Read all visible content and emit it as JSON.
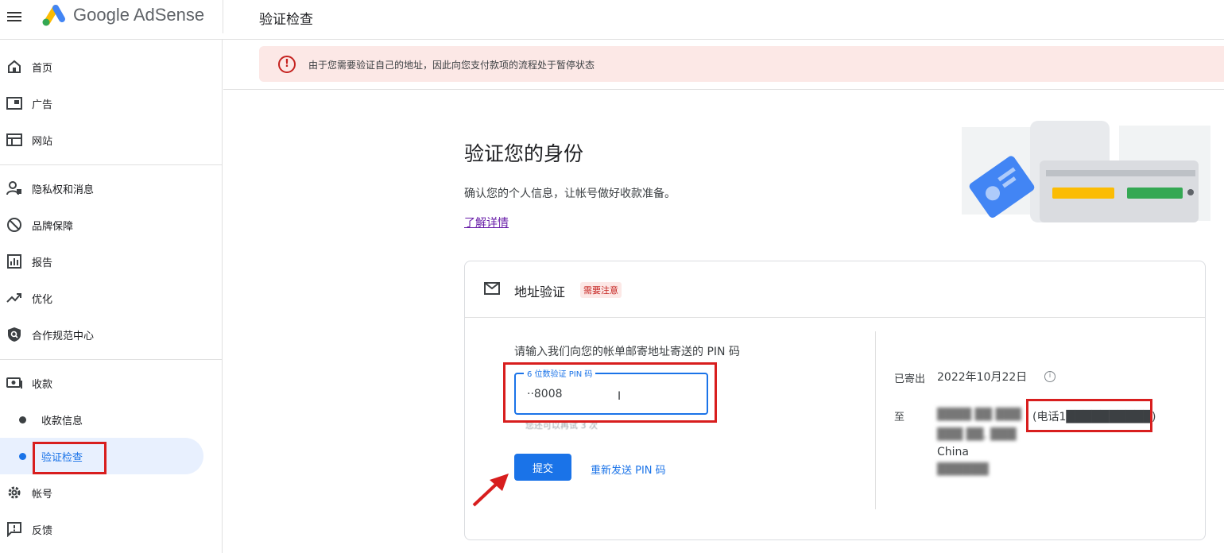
{
  "topbar": {
    "brand": "Google AdSense",
    "page_title": "验证检查"
  },
  "sidebar": {
    "items": [
      {
        "label": "首页",
        "icon": "home-icon"
      },
      {
        "label": "广告",
        "icon": "ads-icon"
      },
      {
        "label": "网站",
        "icon": "sites-icon"
      },
      {
        "label": "隐私权和消息",
        "icon": "privacy-icon"
      },
      {
        "label": "品牌保障",
        "icon": "block-icon"
      },
      {
        "label": "报告",
        "icon": "reports-icon"
      },
      {
        "label": "优化",
        "icon": "trending-icon"
      },
      {
        "label": "合作规范中心",
        "icon": "policy-icon"
      },
      {
        "label": "收款",
        "icon": "payments-icon"
      },
      {
        "label": "收款信息"
      },
      {
        "label": "验证检查"
      },
      {
        "label": "帐号",
        "icon": "gear-icon"
      },
      {
        "label": "反馈",
        "icon": "feedback-icon"
      }
    ]
  },
  "alert": {
    "icon": "alert-icon",
    "text": "由于您需要验证自己的地址，因此向您支付款项的流程处于暂停状态"
  },
  "main": {
    "heading": "验证您的身份",
    "subheading": "确认您的个人信息，让帐号做好收款准备。",
    "learn_more": "了解详情"
  },
  "card": {
    "title": "地址验证",
    "badge": "需要注意",
    "pin_prompt": "请输入我们向您的帐单邮寄地址寄送的 PIN 码",
    "pin_label": "6 位数验证 PIN 码",
    "pin_value": "··8008",
    "hint": "您还可以再试 3 次",
    "submit_label": "提交",
    "resend_label": "重新发送 PIN 码",
    "sent_label": "已寄出",
    "sent_date": "2022年10月22日",
    "to_label": "至",
    "address_line1": "████ ██ ███",
    "phone": "(电话1██████████)",
    "address_line2": "███ ██, ███",
    "country": "China",
    "postal": "██████"
  },
  "colors": {
    "accent": "#1a73e8",
    "alert_bg": "#fce8e6",
    "alert_fg": "#c5221f",
    "annotation_red": "#d81e1e"
  }
}
